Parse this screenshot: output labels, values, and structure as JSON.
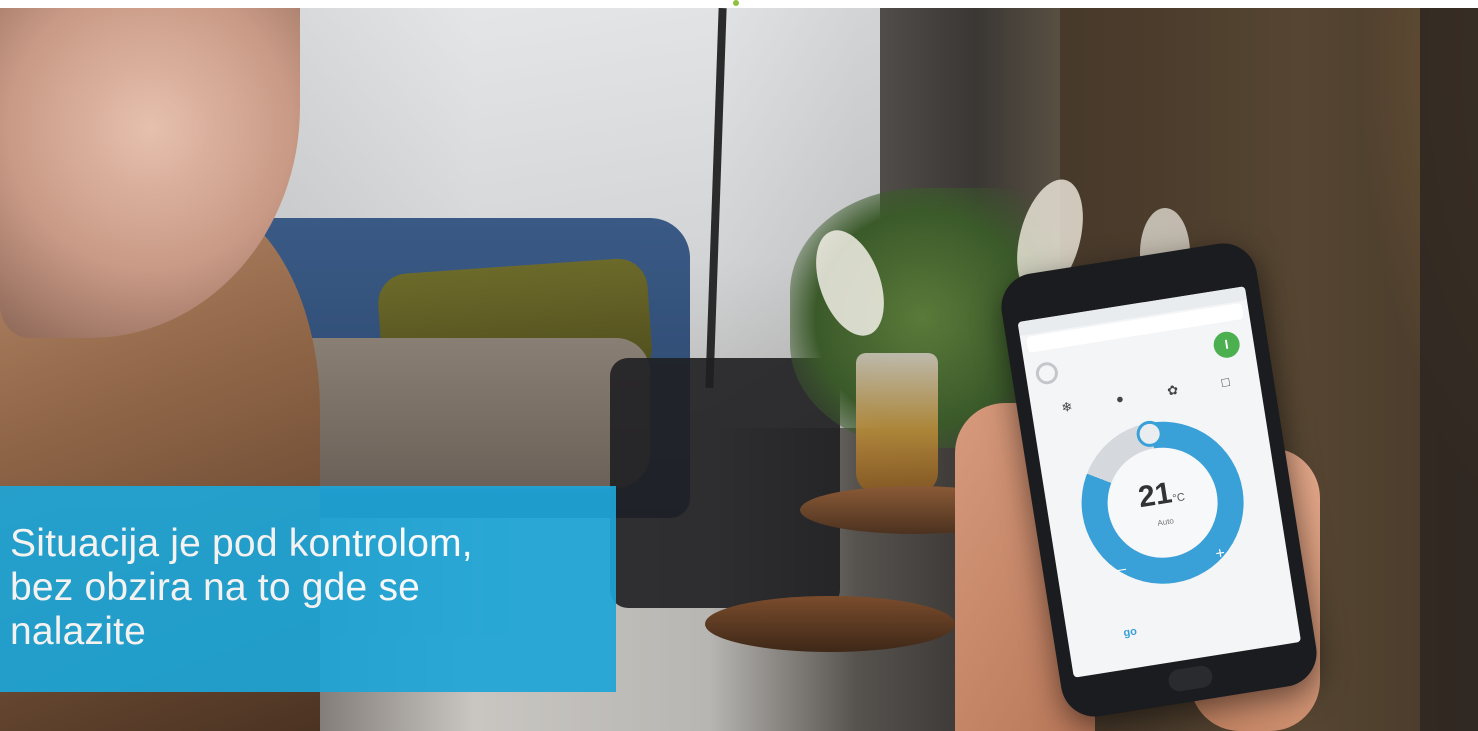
{
  "caption": {
    "lines": [
      "Situacija je pod kontrolom,",
      "bez obzira na to gde se",
      "nalazite"
    ],
    "background_color": "#1ea5d6",
    "text_color": "#ffffff"
  },
  "phone_app": {
    "temperature": "21",
    "unit": "°C",
    "mode": "Auto",
    "minus_label": "–",
    "plus_label": "+",
    "power_button_label": "I",
    "go_label": "go",
    "mode_icons": [
      "cool-icon",
      "sun-icon",
      "fan-icon",
      "dry-icon"
    ],
    "accent_color": "#3aa0d8",
    "power_color": "#4caf50"
  },
  "scene": {
    "icons": [
      "power-icon",
      "snowflake-icon",
      "fan-icon"
    ]
  }
}
